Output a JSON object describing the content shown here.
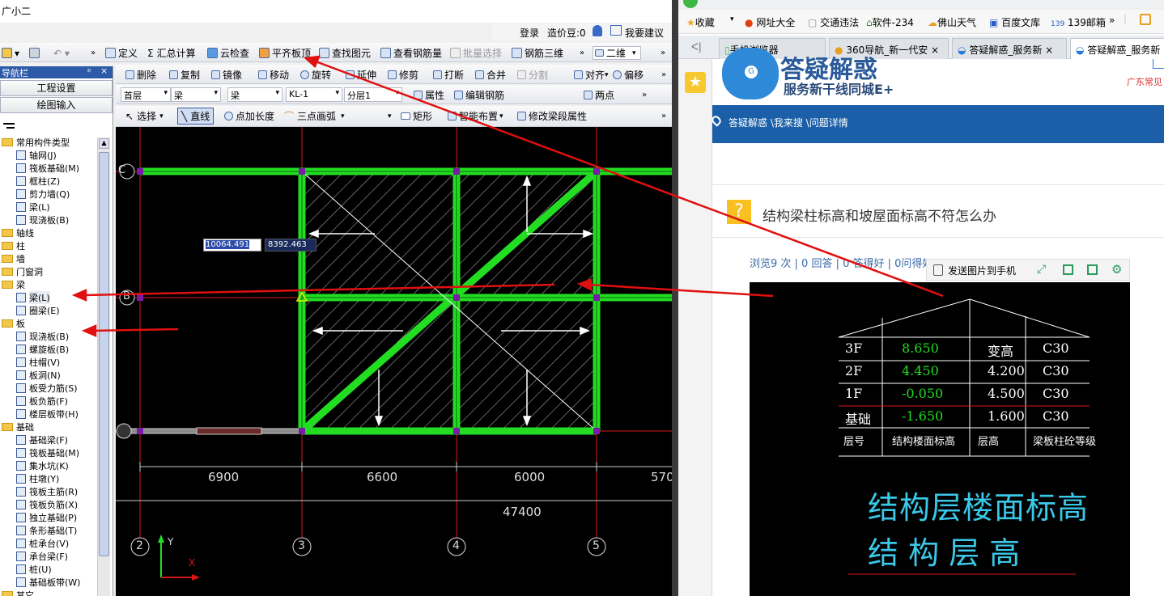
{
  "left_app": {
    "title": "广小二",
    "login": {
      "login_label": "登录",
      "bean_label": "造价豆:0",
      "help_label": "我要建议"
    },
    "toolbar1": [
      {
        "label": "定义"
      },
      {
        "label": "汇总计算"
      },
      {
        "label": "云检查"
      },
      {
        "label": "平齐板顶"
      },
      {
        "label": "查找图元"
      },
      {
        "label": "查看钢筋量"
      },
      {
        "label": "批量选择"
      },
      {
        "label": "钢筋三维"
      }
    ],
    "view_mode": "二维",
    "toolbar2": [
      {
        "label": "删除"
      },
      {
        "label": "复制"
      },
      {
        "label": "镜像"
      },
      {
        "label": "移动"
      },
      {
        "label": "旋转"
      },
      {
        "label": "延伸"
      },
      {
        "label": "修剪"
      },
      {
        "label": "打断"
      },
      {
        "label": "合并"
      },
      {
        "label": "分割"
      },
      {
        "label": "对齐"
      },
      {
        "label": "偏移"
      }
    ],
    "toolbar3": {
      "floor": "首层",
      "category": "梁",
      "type": "梁",
      "name": "KL-1",
      "layer": "分层1",
      "property_label": "属性",
      "edit_rebar_label": "编辑钢筋",
      "two_point_label": "两点"
    },
    "toolbar4": [
      {
        "label": "选择"
      },
      {
        "label": "直线"
      },
      {
        "label": "点加长度"
      },
      {
        "label": "三点画弧"
      },
      {
        "label": "矩形"
      },
      {
        "label": "智能布置"
      },
      {
        "label": "修改梁段属性"
      }
    ],
    "nav": {
      "title": "导航栏",
      "pin": "ᵖ",
      "close": "×",
      "buttons": [
        {
          "label": "工程设置"
        },
        {
          "label": "绘图输入"
        }
      ],
      "tree": [
        {
          "label": "常用构件类型",
          "folder": true,
          "indent": 0
        },
        {
          "label": "轴网(J)",
          "indent": 1
        },
        {
          "label": "筏板基础(M)",
          "indent": 1
        },
        {
          "label": "框柱(Z)",
          "indent": 1
        },
        {
          "label": "剪力墙(Q)",
          "indent": 1
        },
        {
          "label": "梁(L)",
          "indent": 1
        },
        {
          "label": "现浇板(B)",
          "indent": 1
        },
        {
          "label": "轴线",
          "folder": true,
          "indent": 0
        },
        {
          "label": "柱",
          "folder": true,
          "indent": 0
        },
        {
          "label": "墙",
          "folder": true,
          "indent": 0
        },
        {
          "label": "门窗洞",
          "folder": true,
          "indent": 0
        },
        {
          "label": "梁",
          "folder": true,
          "indent": 0
        },
        {
          "label": "梁(L)",
          "indent": 1
        },
        {
          "label": "圈梁(E)",
          "indent": 1
        },
        {
          "label": "板",
          "folder": true,
          "indent": 0
        },
        {
          "label": "现浇板(B)",
          "indent": 1
        },
        {
          "label": "螺旋板(B)",
          "indent": 1
        },
        {
          "label": "柱帽(V)",
          "indent": 1
        },
        {
          "label": "板洞(N)",
          "indent": 1
        },
        {
          "label": "板受力筋(S)",
          "indent": 1
        },
        {
          "label": "板负筋(F)",
          "indent": 1
        },
        {
          "label": "楼层板带(H)",
          "indent": 1
        },
        {
          "label": "基础",
          "folder": true,
          "indent": 0
        },
        {
          "label": "基础梁(F)",
          "indent": 1
        },
        {
          "label": "筏板基础(M)",
          "indent": 1
        },
        {
          "label": "集水坑(K)",
          "indent": 1
        },
        {
          "label": "柱墩(Y)",
          "indent": 1
        },
        {
          "label": "筏板主筋(R)",
          "indent": 1
        },
        {
          "label": "筏板负筋(X)",
          "indent": 1
        },
        {
          "label": "独立基础(P)",
          "indent": 1
        },
        {
          "label": "条形基础(T)",
          "indent": 1
        },
        {
          "label": "桩承台(V)",
          "indent": 1
        },
        {
          "label": "承台梁(F)",
          "indent": 1
        },
        {
          "label": "桩(U)",
          "indent": 1
        },
        {
          "label": "基础板带(W)",
          "indent": 1
        },
        {
          "label": "其它",
          "folder": true,
          "indent": 0
        }
      ]
    },
    "drawing": {
      "coord_x": "10064.491",
      "coord_y": "8392.463",
      "row_labels": [
        "C",
        "B"
      ],
      "col_labels": [
        "2",
        "3",
        "4",
        "5"
      ],
      "dims": [
        "6900",
        "6600",
        "6000",
        "570"
      ],
      "total_dim": "47400",
      "axis_y": "Y",
      "axis_x": "X"
    }
  },
  "right_app": {
    "bookmarks": [
      {
        "label": "收藏"
      },
      {
        "label": "网址大全"
      },
      {
        "label": "交通违法"
      },
      {
        "label": "软件-234"
      },
      {
        "label": "佛山天气"
      },
      {
        "label": "百度文库"
      },
      {
        "label": "139邮箱"
      }
    ],
    "tabs": [
      {
        "label": "手机浏览器"
      },
      {
        "label": "360导航_新一代安"
      },
      {
        "label": "答疑解惑_服务新"
      },
      {
        "label": "答疑解惑_服务新"
      }
    ],
    "site": {
      "logo_text": "答疑解惑",
      "slogan": "服务新干线同城E+",
      "region": "广东常见",
      "breadcrumb": "答疑解惑 \\我来搜 \\问题详情",
      "question_title": "结构梁柱标高和坡屋面标高不符怎么办",
      "stats": "浏览9 次 | 0 回答 | 0 答得好 | 0问得好",
      "send_to_phone": "发送图片到手机"
    },
    "image_table": {
      "rows": [
        [
          "3F",
          "8.650",
          "变高",
          "C30"
        ],
        [
          "2F",
          "4.450",
          "4.200",
          "C30"
        ],
        [
          "1F",
          "-0.050",
          "4.500",
          "C30"
        ],
        [
          "基础",
          "-1.650",
          "1.600",
          "C30"
        ],
        [
          "层号",
          "结构楼面标高",
          "层高",
          "梁板柱砼等级"
        ]
      ],
      "caption1": "结构层楼面标高",
      "caption2": "结 构 层 高"
    }
  },
  "colors": {
    "beam": "#22dd22",
    "axis_red": "#d81818",
    "nav_blue": "#2c5aa8",
    "site_blue": "#1b5fa8",
    "arrow_red": "#e01010"
  }
}
